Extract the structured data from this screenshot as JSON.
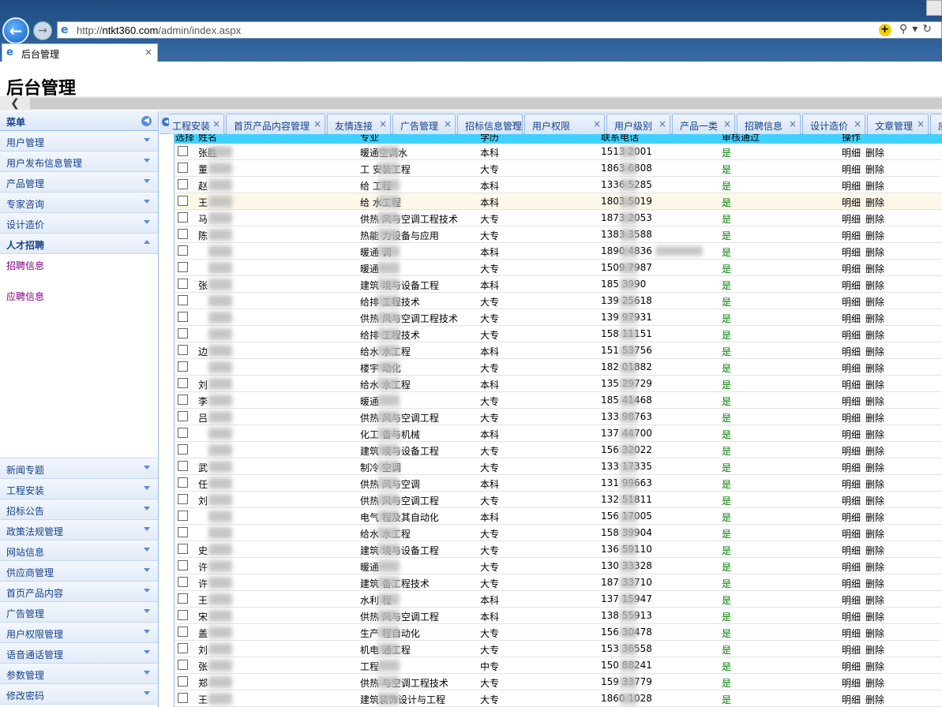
{
  "browser": {
    "url_prefix": "http://",
    "url_host": "ntkt360.com",
    "url_path": "/admin/index.aspx",
    "tab_title": "后台管理",
    "tab_close": "×"
  },
  "page": {
    "title": "后台管理"
  },
  "sidebar": {
    "header": "菜单",
    "top_items": [
      "用户管理",
      "用户发布信息管理",
      "产品管理",
      "专家咨询",
      "设计造价"
    ],
    "open_item": "人才招聘",
    "sub_items": [
      "招聘信息",
      "应聘信息"
    ],
    "bottom_items": [
      "新闻专题",
      "工程安装",
      "招标公告",
      "政策法规管理",
      "网站信息",
      "供应商管理",
      "首页产品内容",
      "广告管理",
      "用户权限管理",
      "语音通话管理",
      "参数管理",
      "修改密码"
    ]
  },
  "tabs": [
    {
      "label": "工程安装",
      "close": "×"
    },
    {
      "label": "首页产品内容管理",
      "close": "×"
    },
    {
      "label": "友情连接",
      "close": "×"
    },
    {
      "label": "广告管理",
      "close": "×"
    },
    {
      "label": "招标信息管理",
      "close": "×"
    },
    {
      "label": "用户权限",
      "close": "×"
    },
    {
      "label": "用户级别",
      "close": "×"
    },
    {
      "label": "产品一类",
      "close": "×"
    },
    {
      "label": "招聘信息",
      "close": "×"
    },
    {
      "label": "设计造价",
      "close": "×"
    },
    {
      "label": "文章管理",
      "close": "×"
    },
    {
      "label": "应",
      "close": ""
    }
  ],
  "grid": {
    "columns": [
      "选择",
      "姓名",
      "专业",
      "学历",
      "联系电话",
      "审核通过",
      "操作"
    ],
    "action_detail": "明细",
    "action_delete": "删除",
    "rows": [
      {
        "name": "张胜",
        "major": "暖通空调水",
        "edu": "本科",
        "phone": "1513   2001",
        "ok": "是"
      },
      {
        "name": "董",
        "major": "工    安装工程",
        "edu": "大专",
        "phone": "1863    6808",
        "ok": "是"
      },
      {
        "name": "赵",
        "major": "给    工程",
        "edu": "本科",
        "phone": "1336    5285",
        "ok": "是"
      },
      {
        "name": "王",
        "major": "给    水工程",
        "edu": "本科",
        "phone": "1803    5019",
        "ok": "是"
      },
      {
        "name": "马",
        "major": "供热    风与空调工程技术",
        "edu": "大专",
        "phone": "1873    2053",
        "ok": "是"
      },
      {
        "name": "陈",
        "major": "热能    力设备与应用",
        "edu": "大专",
        "phone": "1383    3588",
        "ok": "是"
      },
      {
        "name": "",
        "major": "暖通    调",
        "edu": "本科",
        "phone": "1890    4836",
        "ok": "是"
      },
      {
        "name": "",
        "major": "暖通",
        "edu": "大专",
        "phone": "1509    7987",
        "ok": "是"
      },
      {
        "name": "张",
        "major": "建筑    境与设备工程",
        "edu": "本科",
        "phone": "185    3990",
        "ok": "是"
      },
      {
        "name": "",
        "major": "给排    工程技术",
        "edu": "大专",
        "phone": "139    25618",
        "ok": "是"
      },
      {
        "name": "",
        "major": "供热    风与空调工程技术",
        "edu": "大专",
        "phone": "139    97931",
        "ok": "是"
      },
      {
        "name": "",
        "major": "给排    工程技术",
        "edu": "大专",
        "phone": "158    11151",
        "ok": "是"
      },
      {
        "name": "边",
        "major": "给水    水工程",
        "edu": "本科",
        "phone": "151    53756",
        "ok": "是"
      },
      {
        "name": "",
        "major": "楼宇    动化",
        "edu": "大专",
        "phone": "182    01882",
        "ok": "是"
      },
      {
        "name": "刘",
        "major": "给水    水工程",
        "edu": "本科",
        "phone": "135    29729",
        "ok": "是"
      },
      {
        "name": "李",
        "major": "暖通",
        "edu": "大专",
        "phone": "185    41468",
        "ok": "是"
      },
      {
        "name": "吕",
        "major": "供热    风与空调工程",
        "edu": "大专",
        "phone": "133    98763",
        "ok": "是"
      },
      {
        "name": "",
        "major": "化工    备与机械",
        "edu": "本科",
        "phone": "137    44700",
        "ok": "是"
      },
      {
        "name": "",
        "major": "建筑    境与设备工程",
        "edu": "大专",
        "phone": "156    32022",
        "ok": "是"
      },
      {
        "name": "武",
        "major": "制冷    空调",
        "edu": "大专",
        "phone": "133    17335",
        "ok": "是"
      },
      {
        "name": "任",
        "major": "供热    风与空调",
        "edu": "本科",
        "phone": "131    99663",
        "ok": "是"
      },
      {
        "name": "刘",
        "major": "供热    风与空调工程",
        "edu": "大专",
        "phone": "132    51811",
        "ok": "是"
      },
      {
        "name": "",
        "major": "电气    程及其自动化",
        "edu": "本科",
        "phone": "156    17005",
        "ok": "是"
      },
      {
        "name": "",
        "major": "给水    水工程",
        "edu": "大专",
        "phone": "158    39904",
        "ok": "是"
      },
      {
        "name": "史",
        "major": "建筑    境与设备工程",
        "edu": "大专",
        "phone": "136    59110",
        "ok": "是"
      },
      {
        "name": "许",
        "major": "暖通",
        "edu": "大专",
        "phone": "130    33328",
        "ok": "是"
      },
      {
        "name": "许",
        "major": "建筑    备工程技术",
        "edu": "大专",
        "phone": "187    33710",
        "ok": "是"
      },
      {
        "name": "王",
        "major": "水利    程",
        "edu": "本科",
        "phone": "137    15947",
        "ok": "是"
      },
      {
        "name": "宋",
        "major": "供热    风与空调工程",
        "edu": "本科",
        "phone": "138    55913",
        "ok": "是"
      },
      {
        "name": "盖",
        "major": "生产    程自动化",
        "edu": "大专",
        "phone": "156    30478",
        "ok": "是"
      },
      {
        "name": "刘",
        "major": "机电    通工程",
        "edu": "大专",
        "phone": "153    36558",
        "ok": "是"
      },
      {
        "name": "张",
        "major": "工程",
        "edu": "中专",
        "phone": "150    88241",
        "ok": "是"
      },
      {
        "name": "郑",
        "major": "供热    与空调工程技术",
        "edu": "大专",
        "phone": "159    33779",
        "ok": "是"
      },
      {
        "name": "王",
        "major": "建筑装饰设计与工程",
        "edu": "大专",
        "phone": "1860    1028",
        "ok": "是"
      }
    ]
  }
}
